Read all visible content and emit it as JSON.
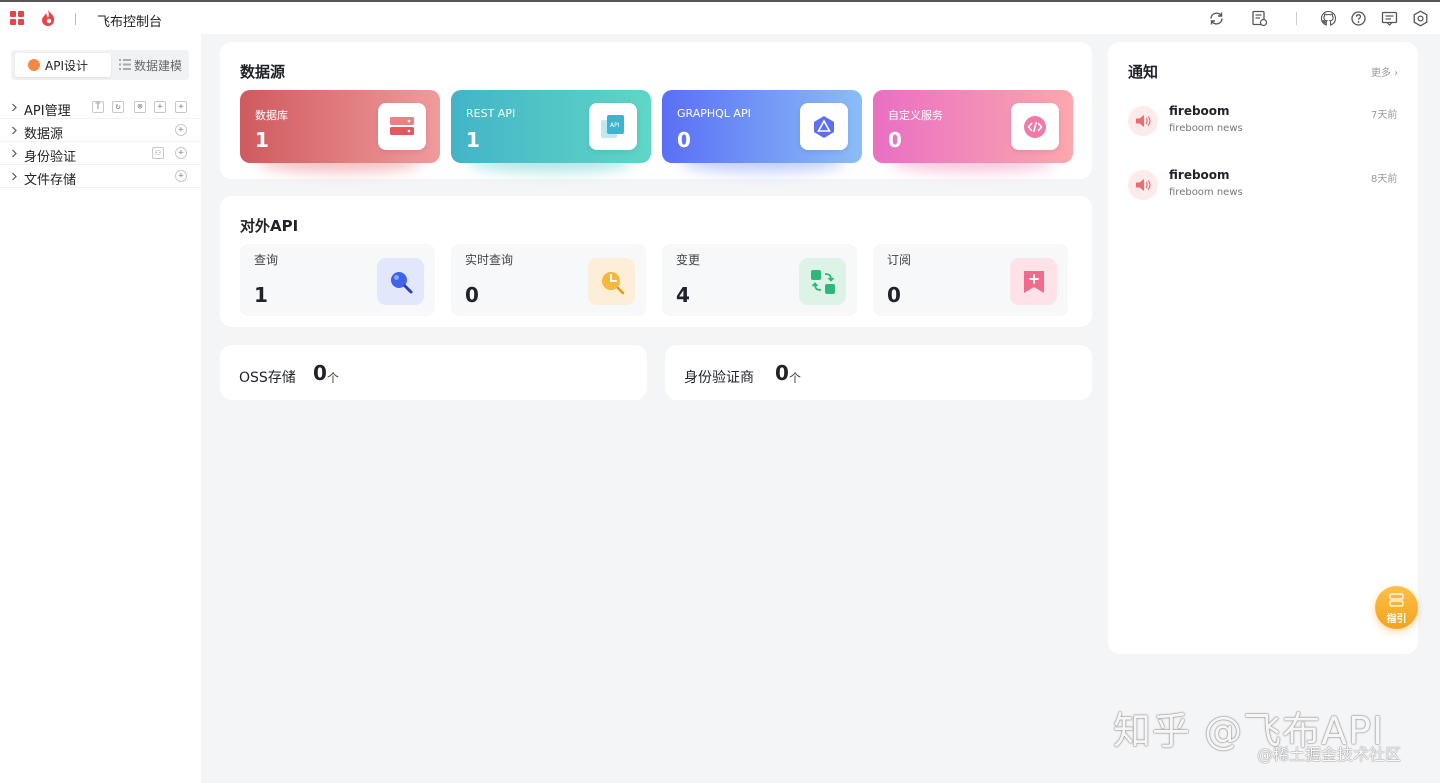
{
  "topbar": {
    "title": "飞布控制台",
    "icons": [
      "apps-icon",
      "flame-logo-icon",
      "refresh-icon",
      "log-icon",
      "github-icon",
      "help-icon",
      "message-icon",
      "settings-icon"
    ]
  },
  "sidebar": {
    "tabs": [
      {
        "label": "API设计",
        "active": true
      },
      {
        "label": "数据建模",
        "active": false
      }
    ],
    "items": [
      {
        "label": "API管理"
      },
      {
        "label": "数据源"
      },
      {
        "label": "身份验证"
      },
      {
        "label": "文件存储"
      }
    ]
  },
  "datasource": {
    "title": "数据源",
    "cards": [
      {
        "label": "数据库",
        "value": "1",
        "colors": [
          "#cf5a5f",
          "#f09b9d"
        ],
        "icon": "database-icon"
      },
      {
        "label": "REST API",
        "value": "1",
        "colors": [
          "#43b4c7",
          "#5fd6c6"
        ],
        "icon": "rest-api-icon"
      },
      {
        "label": "GRAPHQL API",
        "value": "0",
        "colors": [
          "#5a6ff5",
          "#8bbdf7"
        ],
        "icon": "graphql-icon"
      },
      {
        "label": "自定义服务",
        "value": "0",
        "colors": [
          "#e96fc3",
          "#fca7ad"
        ],
        "icon": "code-icon"
      }
    ]
  },
  "api": {
    "title": "对外API",
    "cards": [
      {
        "label": "查询",
        "value": "1",
        "bg": "#e3e7fb",
        "icon": "query-icon"
      },
      {
        "label": "实时查询",
        "value": "0",
        "bg": "#fdefd7",
        "icon": "clock-icon"
      },
      {
        "label": "变更",
        "value": "4",
        "bg": "#ddf3e8",
        "icon": "swap-icon"
      },
      {
        "label": "订阅",
        "value": "0",
        "bg": "#fde2e8",
        "icon": "bookmark-icon"
      }
    ]
  },
  "stats": [
    {
      "label": "OSS存储",
      "value": "0",
      "unit": "个"
    },
    {
      "label": "身份验证商",
      "value": "0",
      "unit": "个"
    }
  ],
  "notifications": {
    "title": "通知",
    "more": "更多",
    "items": [
      {
        "title": "fireboom",
        "subtitle": "fireboom news",
        "time": "7天前"
      },
      {
        "title": "fireboom",
        "subtitle": "fireboom news",
        "time": "8天前"
      }
    ]
  },
  "guide": {
    "label": "指引"
  },
  "watermark": {
    "main": "知乎 @飞布API",
    "sub": "@稀土掘金技术社区"
  }
}
